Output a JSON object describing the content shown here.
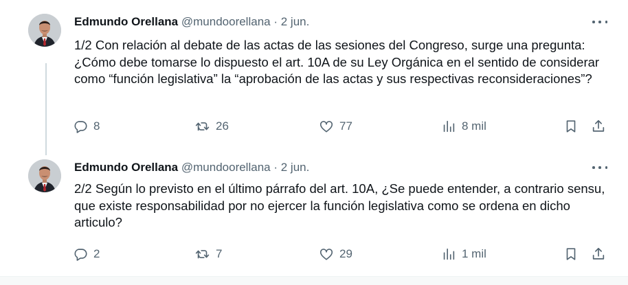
{
  "tweets": [
    {
      "author": "Edmundo Orellana",
      "handle": "@mundoorellana",
      "separator": "·",
      "date": "2 jun.",
      "text": "1/2 Con relación al debate de las actas de las sesiones del Congreso, surge una pregunta: ¿Cómo debe tomarse lo dispuesto el art. 10A de su Ley Orgánica en el sentido de considerar como “función legislativa” la “aprobación de las actas y sus respectivas reconsideraciones”?",
      "replies": "8",
      "retweets": "26",
      "likes": "77",
      "views": "8 mil"
    },
    {
      "author": "Edmundo Orellana",
      "handle": "@mundoorellana",
      "separator": "·",
      "date": "2 jun.",
      "text": "2/2 Según lo previsto en el último párrafo del art. 10A, ¿Se puede entender, a contrario sensu, que existe responsabilidad por no ejercer la función legislativa como se ordena en dicho articulo?",
      "replies": "2",
      "retweets": "7",
      "likes": "29",
      "views": "1 mil"
    }
  ],
  "icons": {
    "reply": "reply-icon",
    "retweet": "retweet-icon",
    "like": "heart-icon",
    "views": "views-icon",
    "bookmark": "bookmark-icon",
    "share": "share-icon",
    "more": "more-icon"
  },
  "colors": {
    "text": "#0f1419",
    "secondary": "#536471",
    "thread_line": "#cfd9de"
  }
}
